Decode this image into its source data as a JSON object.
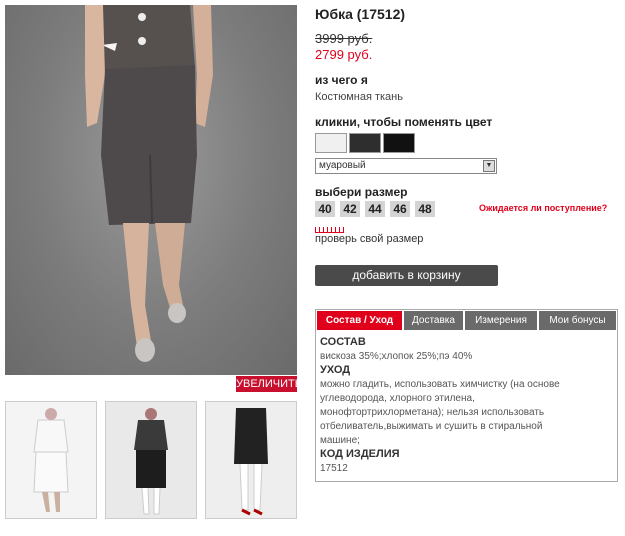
{
  "product": {
    "title": "Юбка (17512)",
    "old_price": "3999 руб.",
    "new_price": "2799 руб."
  },
  "gallery": {
    "zoom_label": "УВЕЛИЧИТЬ"
  },
  "material": {
    "label": "из чего я",
    "value": "Костюмная ткань"
  },
  "color": {
    "label": "кликни, чтобы поменять цвет",
    "selected": "муаровый"
  },
  "size": {
    "label": "выбери размер",
    "options": [
      "40",
      "42",
      "44",
      "46",
      "48"
    ],
    "await_link": "Ожидается ли поступление?",
    "check_link": "проверь свой размер"
  },
  "cart": {
    "button": "добавить в корзину"
  },
  "tabs": {
    "items": [
      "Состав / Уход",
      "Доставка",
      "Измерения",
      "Мои бонусы"
    ],
    "content": {
      "composition_heading": "СОСТАВ",
      "composition_text": "вискоза 35%;хлопок 25%;пэ 40%",
      "care_heading": "УХОД",
      "care_line1": "можно гладить, использовать химчистку (на основе",
      "care_line2": "углеводорода, хлорного этилена,",
      "care_line3": "монофтортрихлорметана); нельзя использовать",
      "care_line4": "отбеливатель,выжимать и сушить в стиральной",
      "care_line5": "машине;",
      "code_heading": "КОД ИЗДЕЛИЯ",
      "code_value": "17512"
    }
  },
  "colors": {
    "accent": "#e0001b",
    "button_dark": "#4a4a4a",
    "tab_inactive": "#6a6a6a"
  }
}
